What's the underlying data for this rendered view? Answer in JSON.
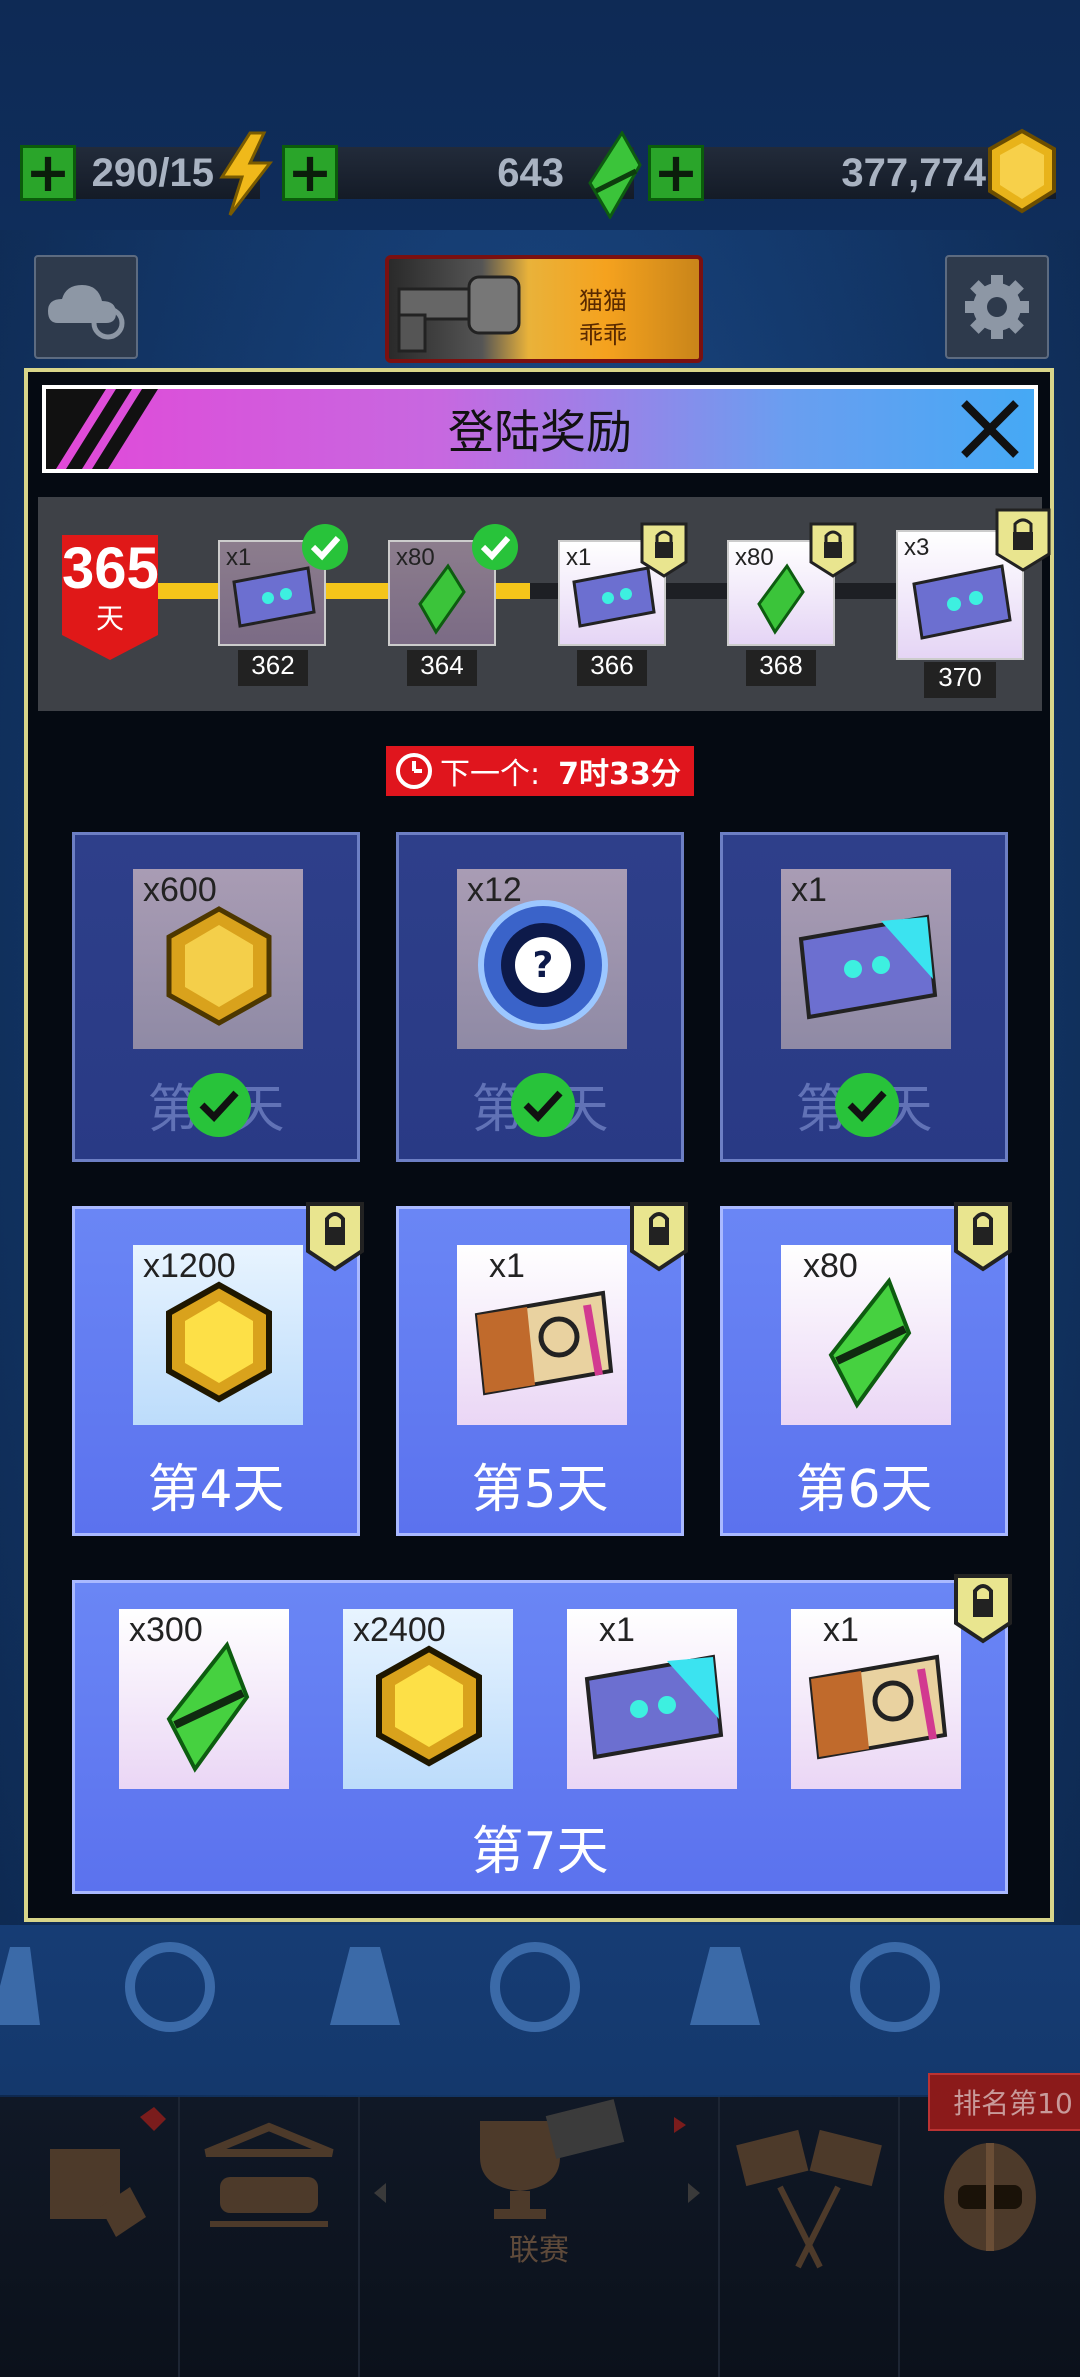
{
  "resources": {
    "energy": "290/15",
    "gems": "643",
    "coins": "377,774"
  },
  "top": {
    "badge_text_1": "猫猫",
    "badge_text_2": "乖乖"
  },
  "modal": {
    "title": "登陆奖励",
    "streak_days_number": "365",
    "streak_days_unit": "天",
    "streak_rewards": [
      {
        "qty": "x1",
        "day": "362",
        "item": "ticket-icon",
        "state": "claimed"
      },
      {
        "qty": "x80",
        "day": "364",
        "item": "green-gem-icon",
        "state": "claimed"
      },
      {
        "qty": "x1",
        "day": "366",
        "item": "ticket-icon",
        "state": "locked"
      },
      {
        "qty": "x80",
        "day": "368",
        "item": "green-gem-icon",
        "state": "locked"
      },
      {
        "qty": "x3",
        "day": "370",
        "item": "ticket-icon",
        "state": "locked"
      }
    ],
    "timer_label": "下一个:",
    "timer_value": "7时33分",
    "days": [
      {
        "qty": "x600",
        "label": "第1天",
        "item": "gold-coin-icon",
        "state": "claimed"
      },
      {
        "qty": "x12",
        "label": "第2天",
        "item": "mystery-token-icon",
        "state": "claimed"
      },
      {
        "qty": "x1",
        "label": "第3天",
        "item": "ticket-icon",
        "state": "claimed"
      },
      {
        "qty": "x1200",
        "label": "第4天",
        "item": "gold-coin-icon",
        "state": "locked"
      },
      {
        "qty": "x1",
        "label": "第5天",
        "item": "turbo-ticket-icon",
        "state": "locked"
      },
      {
        "qty": "x80",
        "label": "第6天",
        "item": "green-gem-icon",
        "state": "locked"
      }
    ],
    "day7": {
      "label": "第7天",
      "rewards": [
        {
          "qty": "x300",
          "item": "green-gem-icon"
        },
        {
          "qty": "x2400",
          "item": "gold-coin-icon"
        },
        {
          "qty": "x1",
          "item": "ticket-icon"
        },
        {
          "qty": "x1",
          "item": "turbo-ticket-icon"
        }
      ]
    }
  },
  "nav": {
    "league_label": "联赛",
    "rank_badge": "排名第10"
  },
  "colors": {
    "accent_yellow": "#f4c51a",
    "check_green": "#28c33a",
    "timer_red": "#e0151d"
  }
}
